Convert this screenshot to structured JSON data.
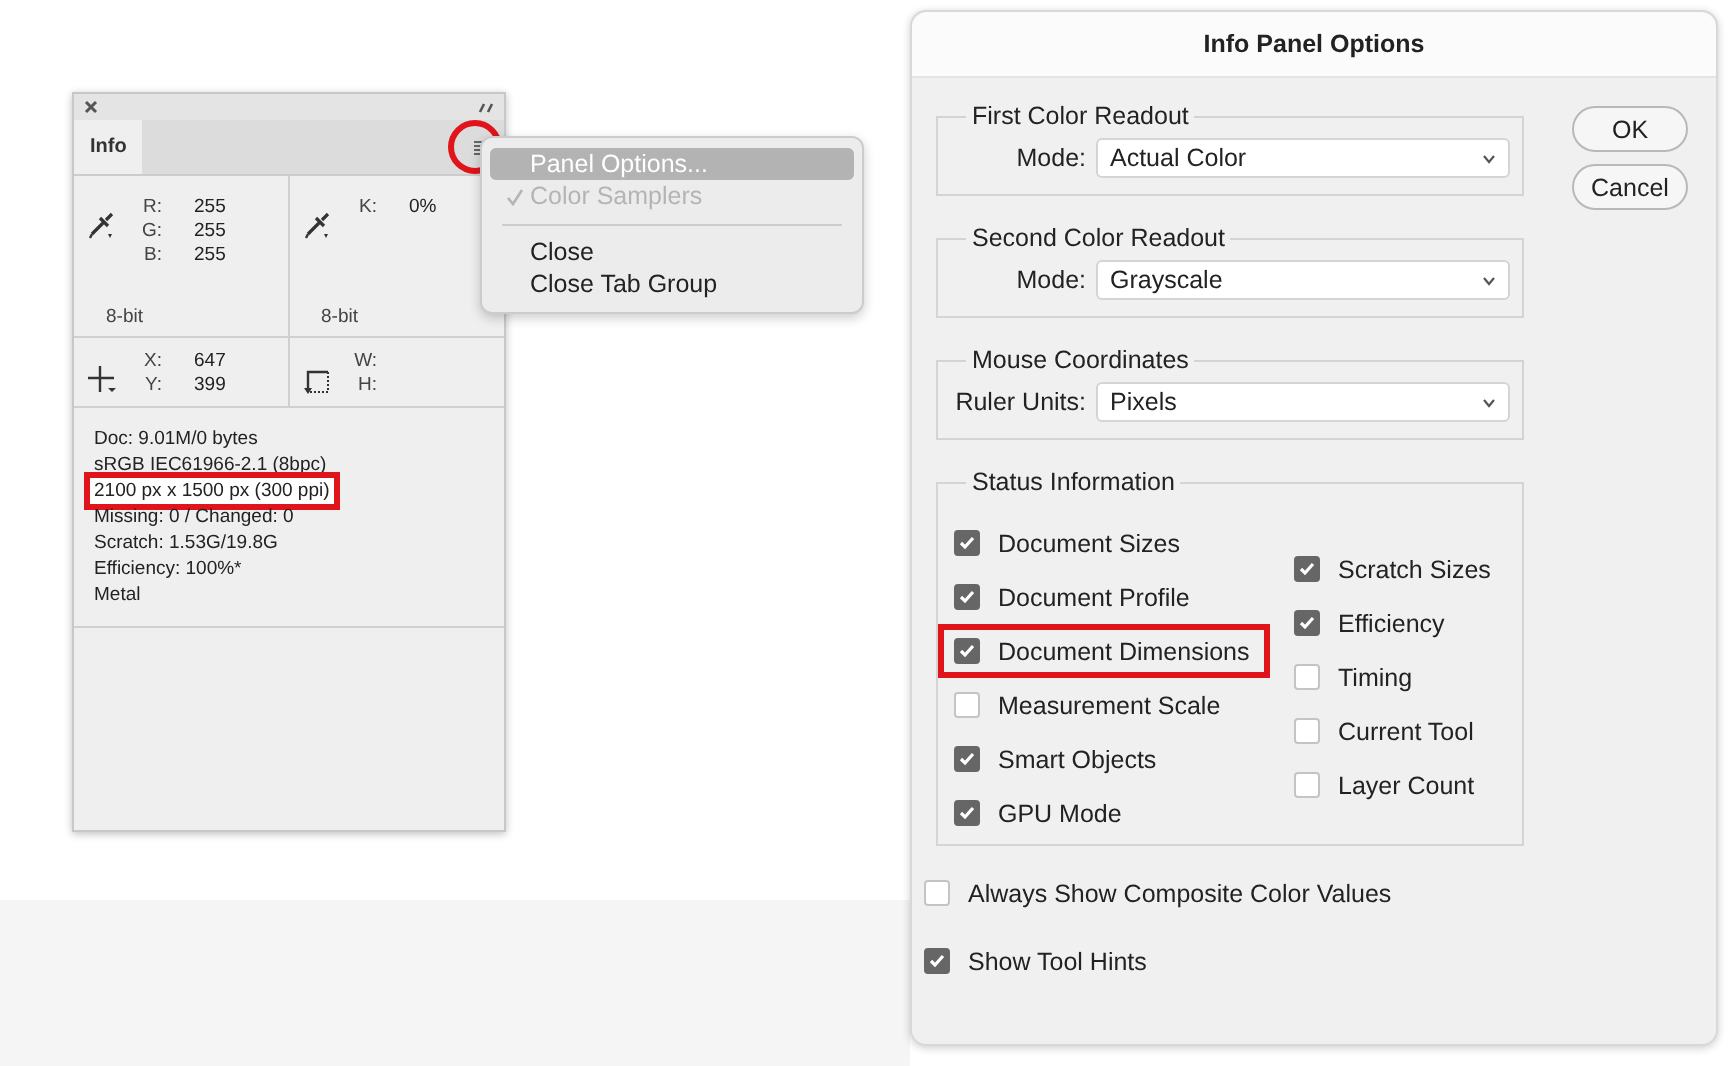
{
  "info_panel": {
    "tabs": [
      {
        "label": "Info",
        "selected": true
      }
    ],
    "menu_button": {
      "highlighted": true
    },
    "readouts": [
      {
        "kind": "color",
        "fields": [
          {
            "label": "R:",
            "value": "255"
          },
          {
            "label": "G:",
            "value": "255"
          },
          {
            "label": "B:",
            "value": "255"
          }
        ],
        "bit_depth": "8-bit"
      },
      {
        "kind": "color",
        "fields": [
          {
            "label": "K:",
            "value": "0%"
          }
        ],
        "bit_depth": "8-bit"
      },
      {
        "kind": "position",
        "fields": [
          {
            "label": "X:",
            "value": "647"
          },
          {
            "label": "Y:",
            "value": "399"
          }
        ]
      },
      {
        "kind": "size",
        "fields": [
          {
            "label": "W:"
          },
          {
            "label": "H:"
          }
        ]
      }
    ],
    "status_lines": [
      {
        "text": "Doc: 9.01M/0 bytes",
        "highlighted": false
      },
      {
        "text": "sRGB IEC61966-2.1 (8bpc)",
        "highlighted": false
      },
      {
        "text": "2100 px x 1500 px (300 ppi)",
        "highlighted": true
      },
      {
        "text": "Missing: 0 / Changed: 0",
        "highlighted": false
      },
      {
        "text": "Scratch: 1.53G/19.8G",
        "highlighted": false
      },
      {
        "text": "Efficiency: 100%*",
        "highlighted": false
      },
      {
        "text": "Metal",
        "highlighted": false
      }
    ]
  },
  "panel_menu": {
    "items": [
      {
        "kind": "item",
        "label": "Panel Options...",
        "selected": true,
        "disabled": false,
        "checked": false
      },
      {
        "kind": "item",
        "label": "Color Samplers",
        "selected": false,
        "disabled": true,
        "checked": true
      },
      {
        "kind": "separator"
      },
      {
        "kind": "item",
        "label": "Close",
        "selected": false,
        "disabled": false,
        "checked": false
      },
      {
        "kind": "item",
        "label": "Close Tab Group",
        "selected": false,
        "disabled": false,
        "checked": false
      }
    ]
  },
  "dialog": {
    "title": "Info Panel Options",
    "groups": [
      {
        "legend": "First Color Readout",
        "label": "Mode:",
        "value": "Actual Color"
      },
      {
        "legend": "Second Color Readout",
        "label": "Mode:",
        "value": "Grayscale"
      },
      {
        "legend": "Mouse Coordinates",
        "label": "Ruler Units:",
        "value": "Pixels"
      }
    ],
    "status_information": {
      "legend": "Status Information",
      "columns": [
        [
          {
            "label": "Document Sizes",
            "checked": true,
            "highlighted": false
          },
          {
            "label": "Document Profile",
            "checked": true,
            "highlighted": false
          },
          {
            "label": "Document Dimensions",
            "checked": true,
            "highlighted": true
          },
          {
            "label": "Measurement Scale",
            "checked": false,
            "highlighted": false
          },
          {
            "label": "Smart Objects",
            "checked": true,
            "highlighted": false
          },
          {
            "label": "GPU Mode",
            "checked": true,
            "highlighted": false
          }
        ],
        [
          {
            "label": "Scratch Sizes",
            "checked": true,
            "highlighted": false
          },
          {
            "label": "Efficiency",
            "checked": true,
            "highlighted": false
          },
          {
            "label": "Timing",
            "checked": false,
            "highlighted": false
          },
          {
            "label": "Current Tool",
            "checked": false,
            "highlighted": false
          },
          {
            "label": "Layer Count",
            "checked": false,
            "highlighted": false
          }
        ]
      ]
    },
    "options": [
      {
        "label": "Always Show Composite Color Values",
        "checked": false
      },
      {
        "label": "Show Tool Hints",
        "checked": true
      }
    ],
    "buttons": [
      {
        "label": "OK"
      },
      {
        "label": "Cancel"
      }
    ]
  }
}
